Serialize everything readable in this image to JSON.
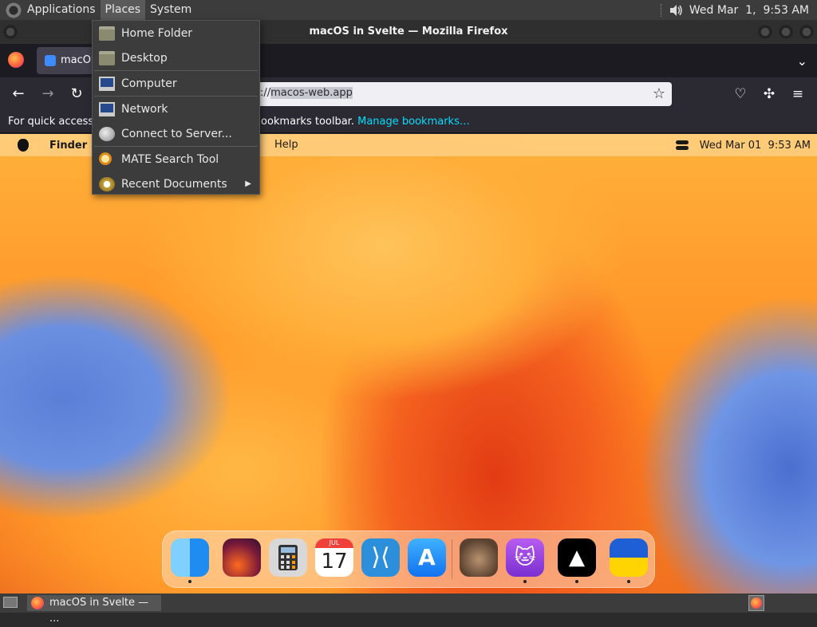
{
  "mate_panel": {
    "menus": [
      "Applications",
      "Places",
      "System"
    ],
    "clock": "Wed Mar  1,  9:53 AM"
  },
  "firefox": {
    "window_title": "macOS in Svelte — Mozilla Firefox",
    "tab_label": "macOS",
    "url_prefix": "://",
    "url_highlight": "macos-web.app",
    "bookmarks_hint_left": "For quick access, p",
    "bookmarks_hint_right": "ookmarks toolbar.",
    "manage_bookmarks": "Manage bookmarks…"
  },
  "places_menu": {
    "items": [
      {
        "label": "Home Folder",
        "icon": "home-folder-icon"
      },
      {
        "label": "Desktop",
        "icon": "desktop-folder-icon"
      },
      {
        "label": "Computer",
        "icon": "computer-icon"
      },
      {
        "label": "Network",
        "icon": "network-icon"
      },
      {
        "label": "Connect to Server...",
        "icon": "connect-server-icon"
      },
      {
        "label": "MATE Search Tool",
        "icon": "search-tool-icon"
      },
      {
        "label": "Recent Documents",
        "icon": "recent-documents-icon",
        "submenu_arrow": "▶"
      }
    ]
  },
  "macos": {
    "app_name": "Finder",
    "help_menu": "Help",
    "clock": "Wed Mar 01  9:53 AM",
    "calendar_month": "JUL",
    "calendar_day": "17",
    "dock_apps": [
      "finder",
      "wallpapers",
      "calculator",
      "calendar",
      "vscode",
      "app-store",
      "cat-photo",
      "github",
      "vercel",
      "ukraine-flag"
    ]
  },
  "bottom_panel": {
    "task_label": "macOS in Svelte — ..."
  },
  "colors": {
    "panel_bg": "#3c3c3c",
    "firefox_toolbar": "#2b2a33",
    "link_accent": "#00ddff"
  }
}
